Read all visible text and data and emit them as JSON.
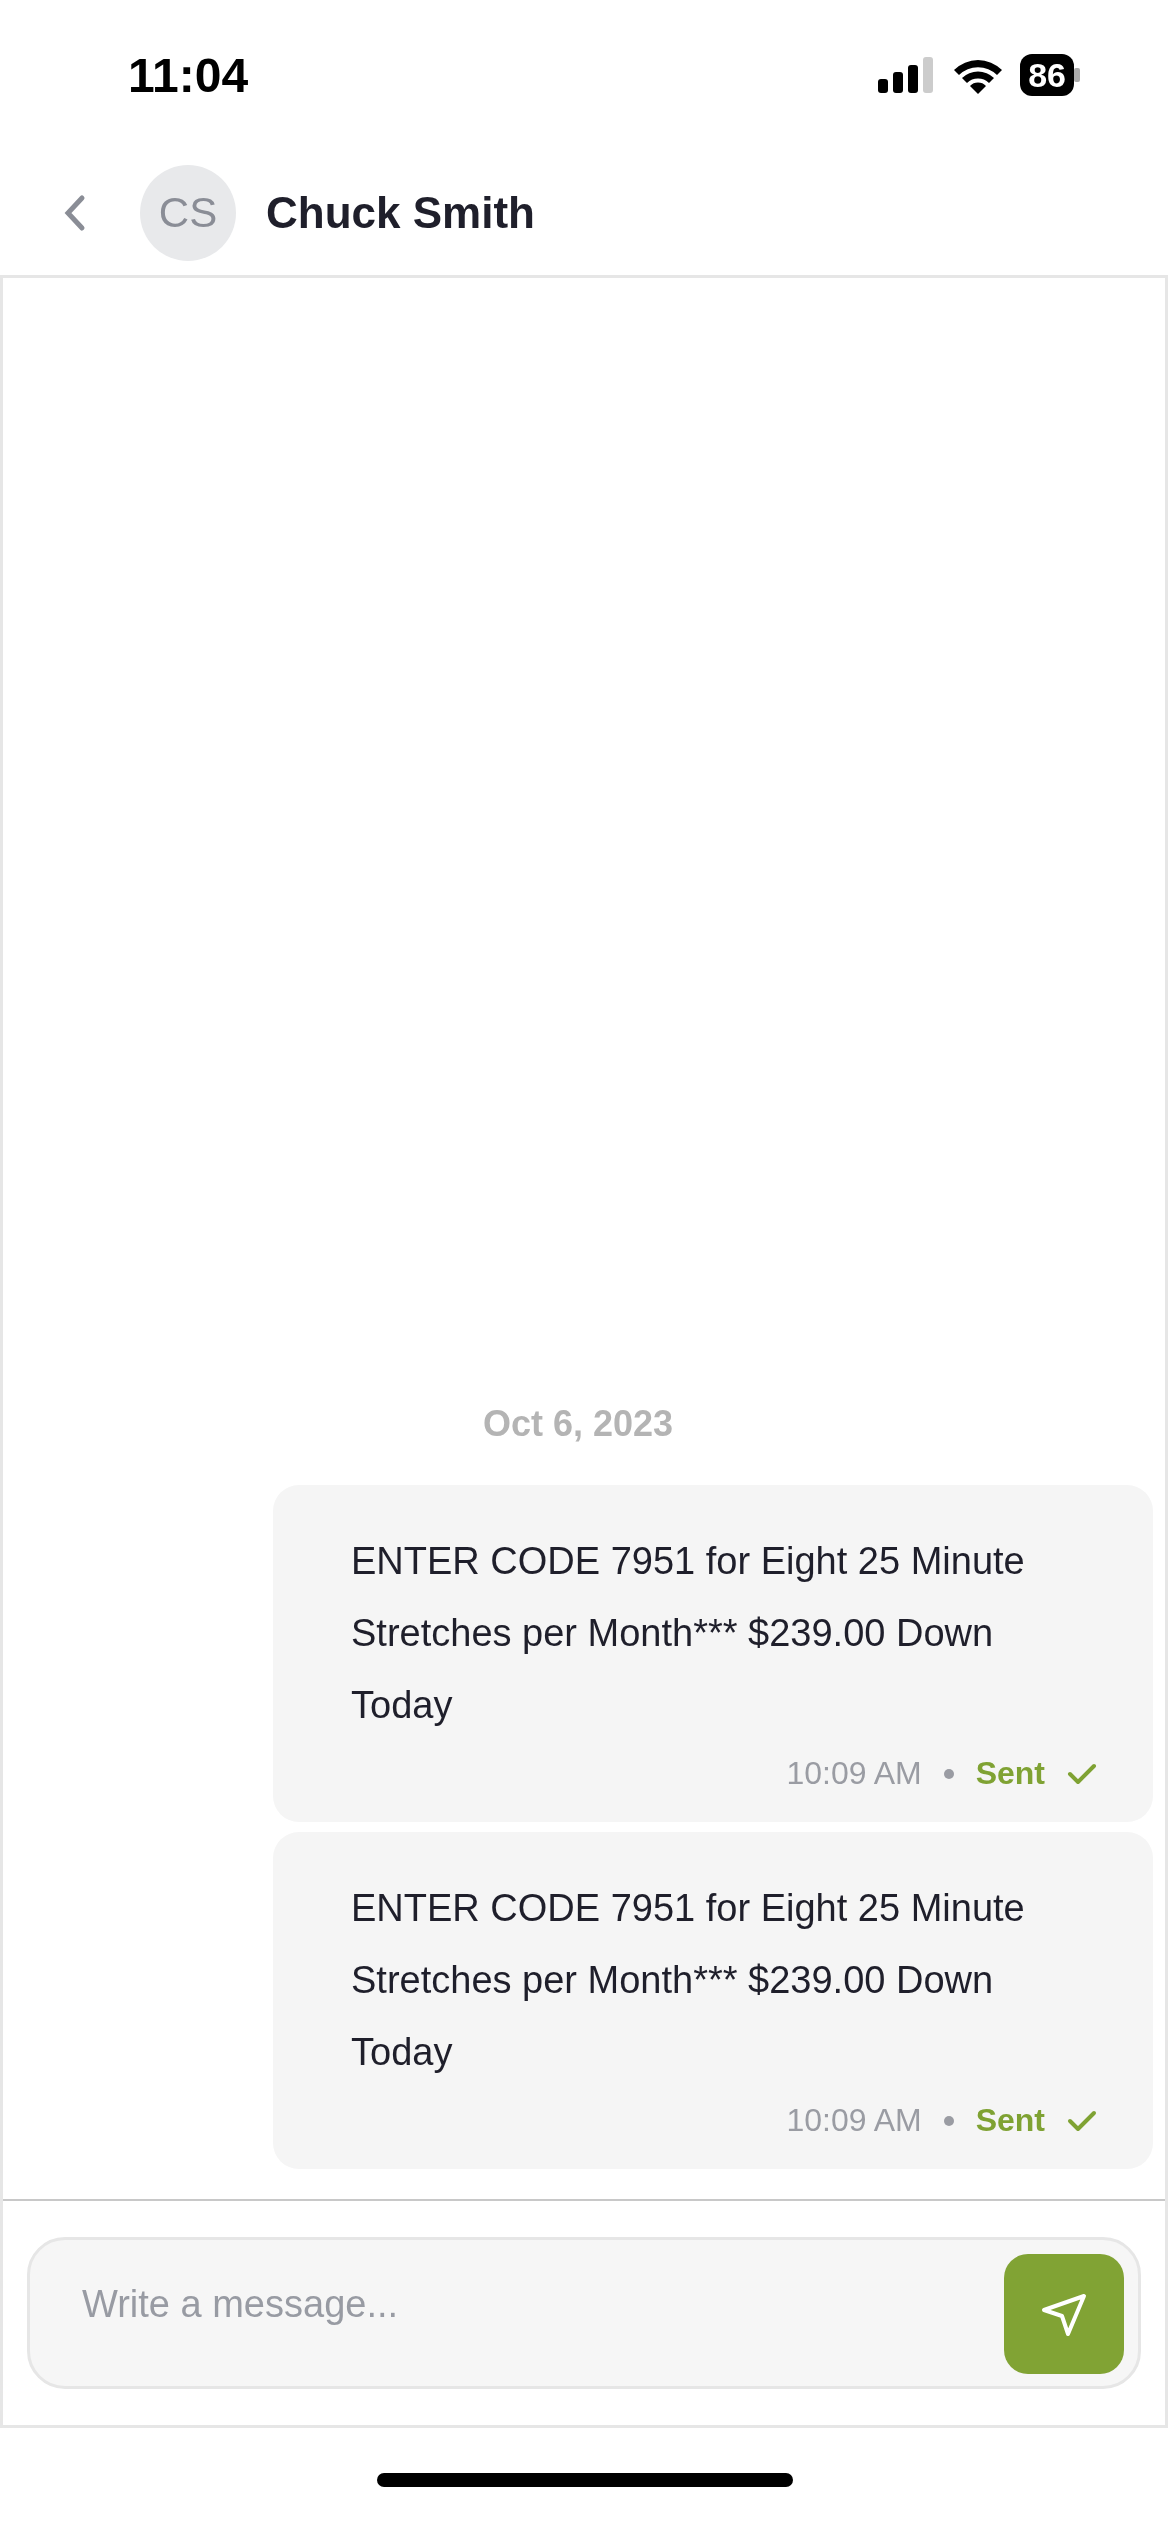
{
  "status_bar": {
    "time": "11:04",
    "battery": "86"
  },
  "header": {
    "avatar_initials": "CS",
    "contact_name": "Chuck Smith"
  },
  "conversation": {
    "date": "Oct 6, 2023",
    "messages": [
      {
        "text": "ENTER CODE 7951 for Eight 25 Minute Stretches per Month*** $239.00 Down Today",
        "time": "10:09 AM",
        "status": "Sent"
      },
      {
        "text": "ENTER CODE 7951 for Eight 25 Minute Stretches per Month*** $239.00 Down Today",
        "time": "10:09 AM",
        "status": "Sent"
      }
    ]
  },
  "composer": {
    "placeholder": "Write a message..."
  }
}
